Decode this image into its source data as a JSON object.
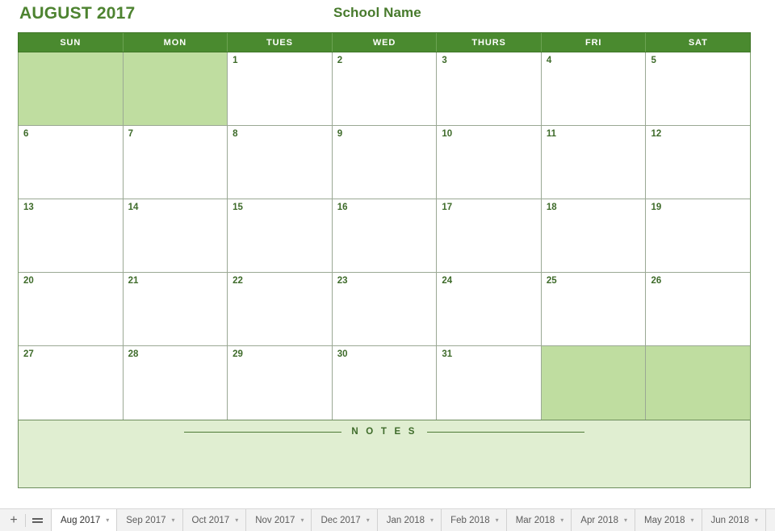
{
  "header": {
    "title": "AUGUST 2017",
    "school_name": "School Name"
  },
  "calendar": {
    "weekdays": [
      "SUN",
      "MON",
      "TUES",
      "WED",
      "THURS",
      "FRI",
      "SAT"
    ],
    "weeks": [
      [
        {
          "label": "",
          "inactive": true
        },
        {
          "label": "",
          "inactive": true
        },
        {
          "label": "1",
          "inactive": false
        },
        {
          "label": "2",
          "inactive": false
        },
        {
          "label": "3",
          "inactive": false
        },
        {
          "label": "4",
          "inactive": false
        },
        {
          "label": "5",
          "inactive": false
        }
      ],
      [
        {
          "label": "6",
          "inactive": false
        },
        {
          "label": "7",
          "inactive": false
        },
        {
          "label": "8",
          "inactive": false
        },
        {
          "label": "9",
          "inactive": false
        },
        {
          "label": "10",
          "inactive": false
        },
        {
          "label": "11",
          "inactive": false
        },
        {
          "label": "12",
          "inactive": false
        }
      ],
      [
        {
          "label": "13",
          "inactive": false
        },
        {
          "label": "14",
          "inactive": false
        },
        {
          "label": "15",
          "inactive": false
        },
        {
          "label": "16",
          "inactive": false
        },
        {
          "label": "17",
          "inactive": false
        },
        {
          "label": "18",
          "inactive": false
        },
        {
          "label": "19",
          "inactive": false
        }
      ],
      [
        {
          "label": "20",
          "inactive": false
        },
        {
          "label": "21",
          "inactive": false
        },
        {
          "label": "22",
          "inactive": false
        },
        {
          "label": "23",
          "inactive": false
        },
        {
          "label": "24",
          "inactive": false
        },
        {
          "label": "25",
          "inactive": false
        },
        {
          "label": "26",
          "inactive": false
        }
      ],
      [
        {
          "label": "27",
          "inactive": false
        },
        {
          "label": "28",
          "inactive": false
        },
        {
          "label": "29",
          "inactive": false
        },
        {
          "label": "30",
          "inactive": false
        },
        {
          "label": "31",
          "inactive": false
        },
        {
          "label": "",
          "inactive": true
        },
        {
          "label": "",
          "inactive": true
        }
      ]
    ]
  },
  "notes": {
    "label": "N O T E S",
    "content": ""
  },
  "tabbar": {
    "add_sheet_icon": "plus-icon",
    "all_sheets_icon": "hamburger-icon",
    "tabs": [
      {
        "label": "Aug 2017",
        "active": true
      },
      {
        "label": "Sep 2017",
        "active": false
      },
      {
        "label": "Oct 2017",
        "active": false
      },
      {
        "label": "Nov 2017",
        "active": false
      },
      {
        "label": "Dec 2017",
        "active": false
      },
      {
        "label": "Jan 2018",
        "active": false
      },
      {
        "label": "Feb 2018",
        "active": false
      },
      {
        "label": "Mar 2018",
        "active": false
      },
      {
        "label": "Apr 2018",
        "active": false
      },
      {
        "label": "May 2018",
        "active": false
      },
      {
        "label": "Jun 2018",
        "active": false
      }
    ],
    "caret_glyph": "▾"
  },
  "colors": {
    "header_green": "#4a8a2f",
    "inactive_green": "#bfdda0",
    "notes_green": "#e0eed1",
    "title_green": "#4d8330",
    "day_number_green": "#3e6b2a"
  }
}
